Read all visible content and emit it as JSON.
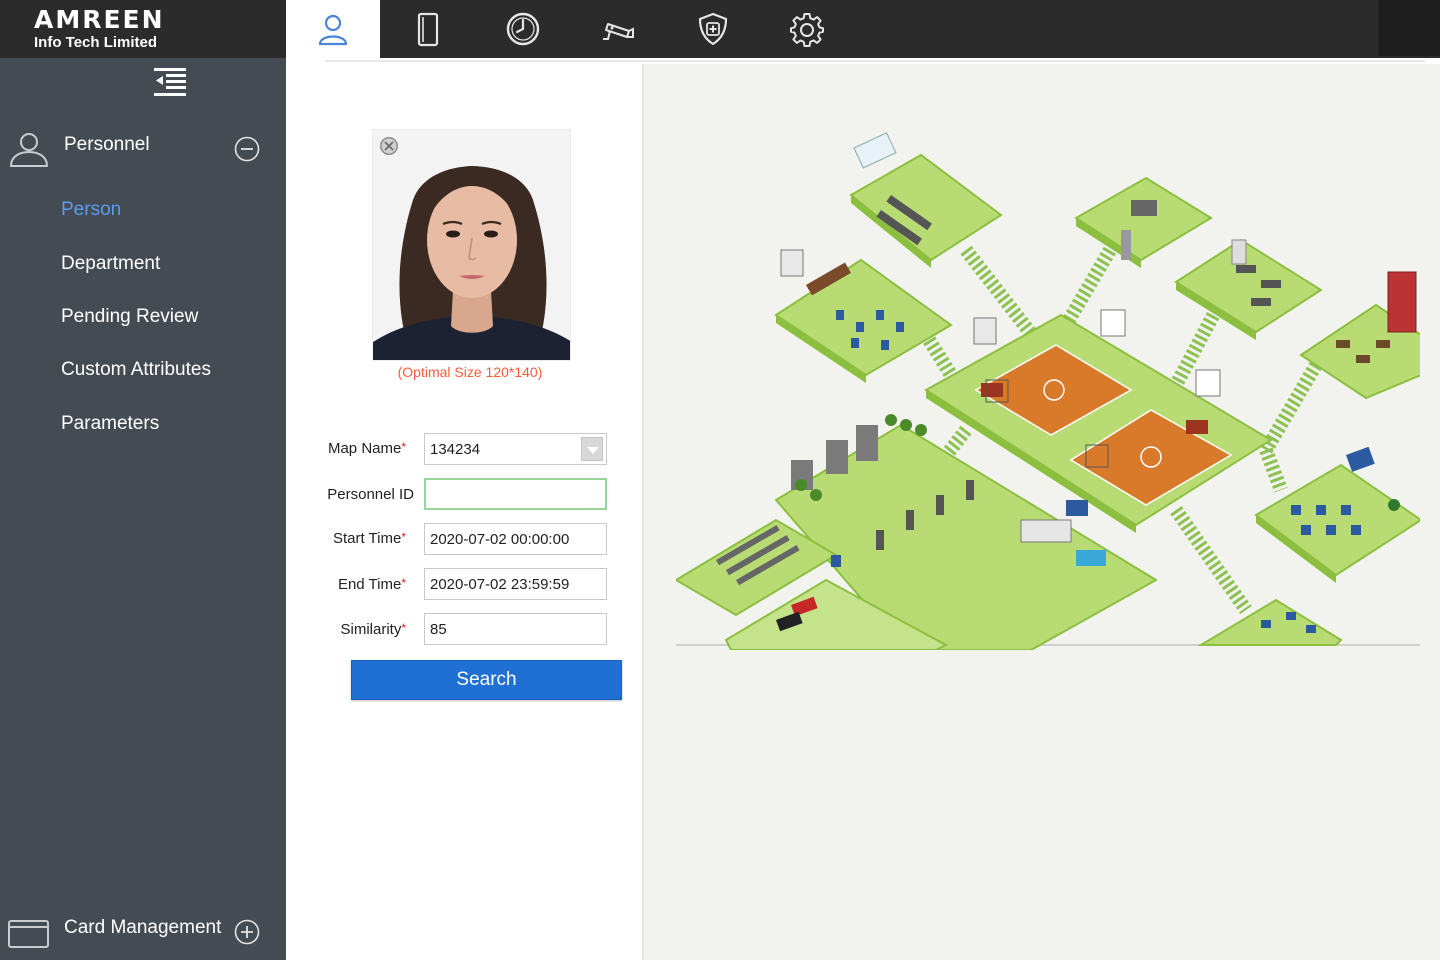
{
  "brand": {
    "name": "AMREEN",
    "subtitle": "Info Tech Limited"
  },
  "top_nav": {
    "tabs": [
      {
        "icon": "person-icon",
        "active": true
      },
      {
        "icon": "door-icon",
        "active": false
      },
      {
        "icon": "clock-icon",
        "active": false
      },
      {
        "icon": "cctv-camera-icon",
        "active": false
      },
      {
        "icon": "shield-plus-icon",
        "active": false
      },
      {
        "icon": "gear-icon",
        "active": false
      }
    ]
  },
  "sidebar": {
    "collapse_icon": "menu-collapse-icon",
    "personnel_group": {
      "label": "Personnel",
      "icon": "person-outline-icon",
      "expanded": true
    },
    "items": [
      {
        "label": "Person",
        "active": true
      },
      {
        "label": "Department",
        "active": false
      },
      {
        "label": "Pending Review",
        "active": false
      },
      {
        "label": "Custom Attributes",
        "active": false
      },
      {
        "label": "Parameters",
        "active": false
      }
    ],
    "card_group": {
      "label": "Card Management",
      "icon": "card-icon",
      "expanded": false
    }
  },
  "search_panel": {
    "photo_hint": "(Optimal Size 120*140)",
    "fields": {
      "map_name": {
        "label": "Map Name",
        "value": "134234"
      },
      "personnel_id": {
        "label": "Personnel ID",
        "value": ""
      },
      "start_time": {
        "label": "Start Time",
        "value": "2020-07-02 00:00:00"
      },
      "end_time": {
        "label": "End Time",
        "value": "2020-07-02 23:59:59"
      },
      "similarity": {
        "label": "Similarity",
        "value": "85"
      }
    },
    "search_button": "Search"
  },
  "colors": {
    "topbar": "#2b2b2b",
    "sidebar": "#454b52",
    "active_item": "#5b9bf0",
    "button": "#1f6fd4",
    "hint": "#ff5a3c",
    "floor_green": "#b8dc73",
    "court_orange": "#d87a2a"
  }
}
